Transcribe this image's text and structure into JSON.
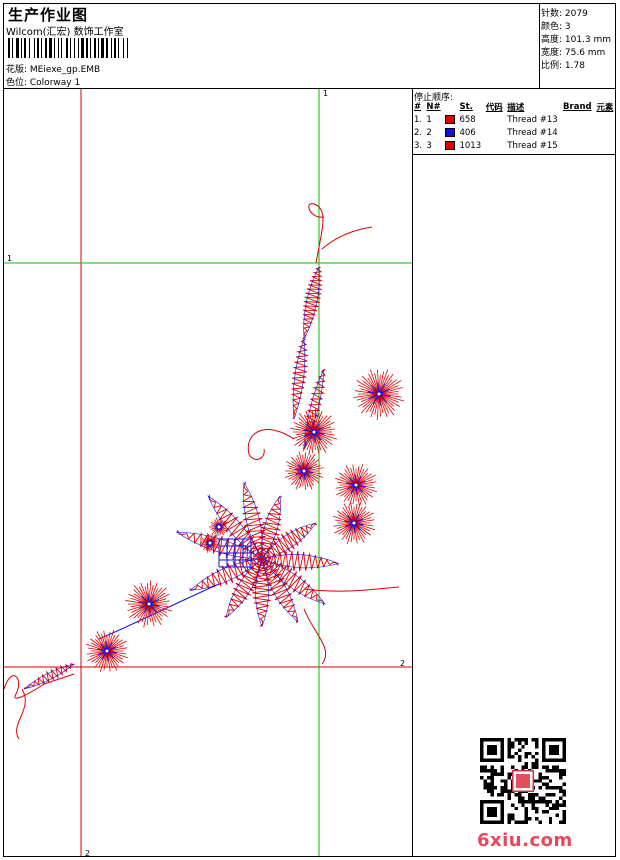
{
  "header": {
    "title": "生产作业图",
    "subtitle": "Wilcom(汇宏) 数饰工作室",
    "file_label": "花版: MEiexe_gp.EMB",
    "colorway_label": "色位: Colorway 1"
  },
  "stats": {
    "stitches": "针数: 2079",
    "colors": "颜色: 3",
    "height": "高度: 101.3 mm",
    "width": "宽度: 75.6 mm",
    "ratio": "比例: 1.78"
  },
  "stops": {
    "title": "停止顺序:",
    "headers": [
      "#",
      "N#",
      "St.",
      "代码",
      "描述",
      "Brand",
      "元素"
    ],
    "rows": [
      {
        "num": "1.",
        "n": "1",
        "color": "#e00000",
        "st": "658",
        "desc": "Thread #13"
      },
      {
        "num": "2.",
        "n": "2",
        "color": "#1010e0",
        "st": "406",
        "desc": "Thread #14"
      },
      {
        "num": "3.",
        "n": "3",
        "color": "#e00000",
        "st": "1013",
        "desc": "Thread #15"
      }
    ]
  },
  "guides": {
    "label_top": "1",
    "label_left": "1",
    "label_right": "2",
    "label_bottom": "2"
  },
  "colors": {
    "thread_red": "#e00000",
    "thread_blue": "#1010e0",
    "guide_red": "#e00000",
    "guide_green": "#00c000",
    "watermark": "#e8495a"
  },
  "icons": {
    "barcode": "barcode-icon",
    "qr": "qr-code-icon"
  },
  "watermark": "6xiu.com"
}
